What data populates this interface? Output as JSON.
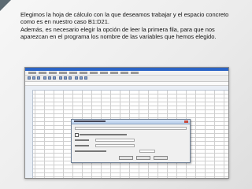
{
  "caption": {
    "paragraph1": "Elegimos la hoja de cálculo con la que deseamos trabajar y el espacio concreto como es en nuestro caso B1:D21.",
    "paragraph2": "Además, es necesario elegir la opción de leer la primera fila, para que nos aparezcan en el programa los nombre de las variables que hemos elegido."
  },
  "screenshot": {
    "dialog_range_value": "B1:D21"
  }
}
